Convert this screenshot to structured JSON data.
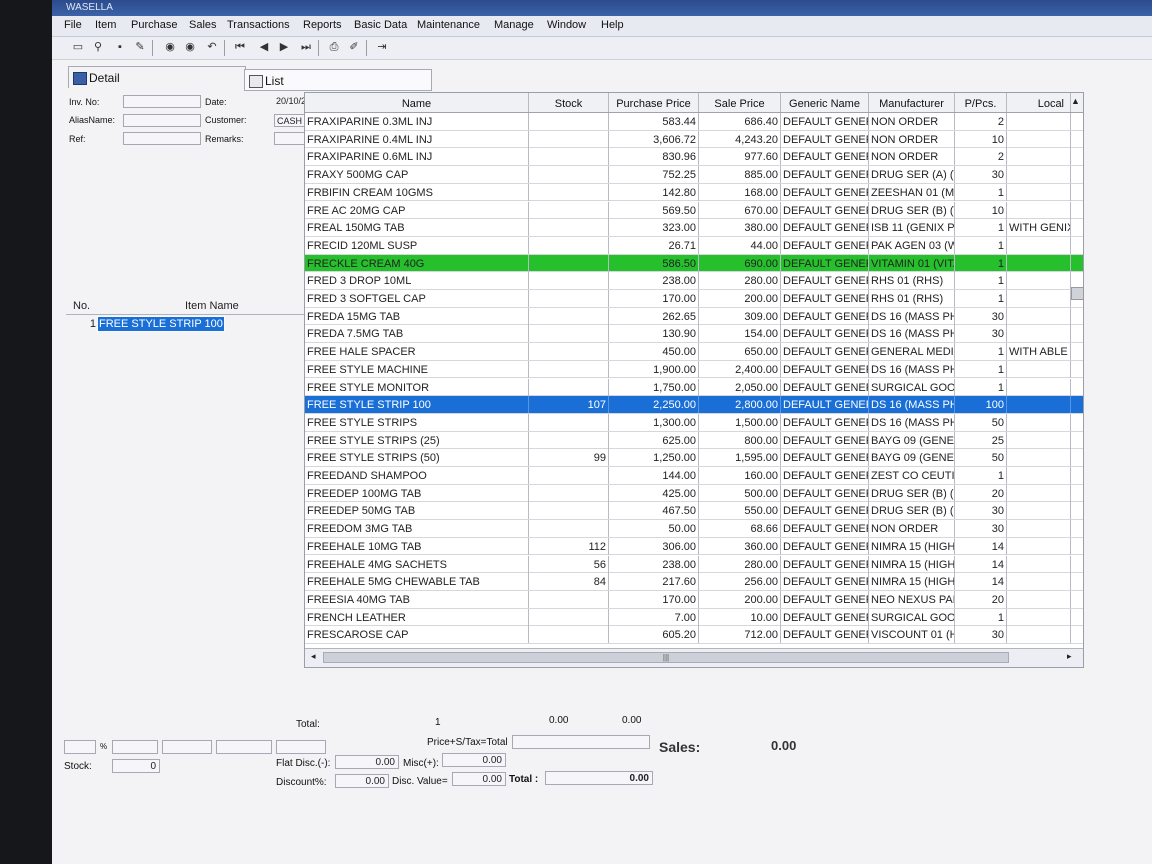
{
  "app": {
    "title": "WASELLA",
    "menu": [
      "File",
      "Item",
      "Purchase",
      "Sales",
      "Transactions",
      "Reports",
      "Basic Data",
      "Maintenance",
      "Manage",
      "Window",
      "Help"
    ]
  },
  "toolbar": {
    "icons": [
      "new-icon",
      "find-icon",
      "save-icon",
      "edit-icon",
      "first-record-icon",
      "last-record-icon",
      "undo-icon",
      "first-page-icon",
      "prev-icon",
      "next-icon",
      "last-page-icon",
      "print-icon",
      "pay-icon",
      "export-icon"
    ]
  },
  "tabs": {
    "detail": "Detail",
    "list": "List"
  },
  "form": {
    "inv_no_label": "Inv. No:",
    "alias_label": "AliasName:",
    "ref_label": "Ref:",
    "date_label": "Date:",
    "date_value": "20/10/2",
    "customer_label": "Customer:",
    "customer_value": "CASH",
    "remarks_label": "Remarks:"
  },
  "items_list": {
    "no_header": "No.",
    "name_header": "Item Name",
    "rows": [
      {
        "no": "1",
        "name": "FREE STYLE STRIP 100"
      }
    ]
  },
  "grid": {
    "headers": [
      "Name",
      "Stock",
      "Purchase Price",
      "Sale Price",
      "Generic Name",
      "Manufacturer",
      "P/Pcs.",
      "Local"
    ],
    "rows": [
      {
        "name": "FRAXIPARINE 0.3ML INJ",
        "stock": "",
        "pp": "583.44",
        "sp": "686.40",
        "gen": "DEFAULT GENER",
        "mfr": "NON ORDER",
        "pcs": "2",
        "local": ""
      },
      {
        "name": "FRAXIPARINE 0.4ML INJ",
        "stock": "",
        "pp": "3,606.72",
        "sp": "4,243.20",
        "gen": "DEFAULT GENER",
        "mfr": "NON ORDER",
        "pcs": "10",
        "local": ""
      },
      {
        "name": "FRAXIPARINE 0.6ML INJ",
        "stock": "",
        "pp": "830.96",
        "sp": "977.60",
        "gen": "DEFAULT GENER",
        "mfr": "NON ORDER",
        "pcs": "2",
        "local": ""
      },
      {
        "name": "FRAXY 500MG CAP",
        "stock": "",
        "pp": "752.25",
        "sp": "885.00",
        "gen": "DEFAULT GENER",
        "mfr": "DRUG SER (A) (T",
        "pcs": "30",
        "local": ""
      },
      {
        "name": "FRBIFIN CREAM 10GMS",
        "stock": "",
        "pp": "142.80",
        "sp": "168.00",
        "gen": "DEFAULT GENER",
        "mfr": "ZEESHAN 01 (MI",
        "pcs": "1",
        "local": ""
      },
      {
        "name": "FRE AC 20MG CAP",
        "stock": "",
        "pp": "569.50",
        "sp": "670.00",
        "gen": "DEFAULT GENER",
        "mfr": "DRUG SER (B) (V",
        "pcs": "10",
        "local": ""
      },
      {
        "name": "FREAL 150MG TAB",
        "stock": "",
        "pp": "323.00",
        "sp": "380.00",
        "gen": "DEFAULT GENER",
        "mfr": "ISB 11 (GENIX PH",
        "pcs": "1",
        "local": "WITH GENIX"
      },
      {
        "name": "FRECID 120ML SUSP",
        "stock": "",
        "pp": "26.71",
        "sp": "44.00",
        "gen": "DEFAULT GENER",
        "mfr": "PAK AGEN 03 (W",
        "pcs": "1",
        "local": ""
      },
      {
        "name": "FRECKLE CREAM 40G",
        "stock": "",
        "pp": "586.50",
        "sp": "690.00",
        "gen": "DEFAULT GENER",
        "mfr": "VITAMIN 01 (VITA",
        "pcs": "1",
        "local": "",
        "hl": "green"
      },
      {
        "name": "FRED 3 DROP 10ML",
        "stock": "",
        "pp": "238.00",
        "sp": "280.00",
        "gen": "DEFAULT GENER",
        "mfr": "RHS 01 (RHS)",
        "pcs": "1",
        "local": ""
      },
      {
        "name": "FRED 3 SOFTGEL CAP",
        "stock": "",
        "pp": "170.00",
        "sp": "200.00",
        "gen": "DEFAULT GENER",
        "mfr": "RHS 01 (RHS)",
        "pcs": "1",
        "local": ""
      },
      {
        "name": "FREDA 15MG TAB",
        "stock": "",
        "pp": "262.65",
        "sp": "309.00",
        "gen": "DEFAULT GENER",
        "mfr": "DS 16 (MASS PH",
        "pcs": "30",
        "local": ""
      },
      {
        "name": "FREDA 7.5MG TAB",
        "stock": "",
        "pp": "130.90",
        "sp": "154.00",
        "gen": "DEFAULT GENER",
        "mfr": "DS 16 (MASS PH",
        "pcs": "30",
        "local": ""
      },
      {
        "name": "FREE HALE SPACER",
        "stock": "",
        "pp": "450.00",
        "sp": "650.00",
        "gen": "DEFAULT GENER",
        "mfr": "GENERAL MEDIC",
        "pcs": "1",
        "local": "WITH ABLE S"
      },
      {
        "name": "FREE STYLE MACHINE",
        "stock": "",
        "pp": "1,900.00",
        "sp": "2,400.00",
        "gen": "DEFAULT GENER",
        "mfr": "DS 16 (MASS PH",
        "pcs": "1",
        "local": ""
      },
      {
        "name": "FREE STYLE MONITOR",
        "stock": "",
        "pp": "1,750.00",
        "sp": "2,050.00",
        "gen": "DEFAULT GENER",
        "mfr": "SURGICAL GOO",
        "pcs": "1",
        "local": ""
      },
      {
        "name": "FREE STYLE STRIP 100",
        "stock": "107",
        "pp": "2,250.00",
        "sp": "2,800.00",
        "gen": "DEFAULT GENER",
        "mfr": "DS 16 (MASS PH",
        "pcs": "100",
        "local": "",
        "hl": "blue"
      },
      {
        "name": "FREE STYLE STRIPS",
        "stock": "",
        "pp": "1,300.00",
        "sp": "1,500.00",
        "gen": "DEFAULT GENER",
        "mfr": "DS 16 (MASS PH",
        "pcs": "50",
        "local": ""
      },
      {
        "name": "FREE STYLE STRIPS (25)",
        "stock": "",
        "pp": "625.00",
        "sp": "800.00",
        "gen": "DEFAULT GENER",
        "mfr": "BAYG 09 (GENER",
        "pcs": "25",
        "local": ""
      },
      {
        "name": "FREE STYLE STRIPS (50)",
        "stock": "99",
        "pp": "1,250.00",
        "sp": "1,595.00",
        "gen": "DEFAULT GENER",
        "mfr": "BAYG 09 (GENER",
        "pcs": "50",
        "local": ""
      },
      {
        "name": "FREEDAND SHAMPOO",
        "stock": "",
        "pp": "144.00",
        "sp": "160.00",
        "gen": "DEFAULT GENER",
        "mfr": "ZEST CO CEUTI",
        "pcs": "1",
        "local": ""
      },
      {
        "name": "FREEDEP 100MG TAB",
        "stock": "",
        "pp": "425.00",
        "sp": "500.00",
        "gen": "DEFAULT GENER",
        "mfr": "DRUG SER (B) (",
        "pcs": "20",
        "local": ""
      },
      {
        "name": "FREEDEP 50MG TAB",
        "stock": "",
        "pp": "467.50",
        "sp": "550.00",
        "gen": "DEFAULT GENER",
        "mfr": "DRUG SER (B) (",
        "pcs": "30",
        "local": ""
      },
      {
        "name": "FREEDOM 3MG TAB",
        "stock": "",
        "pp": "50.00",
        "sp": "68.66",
        "gen": "DEFAULT GENER",
        "mfr": "NON ORDER",
        "pcs": "30",
        "local": ""
      },
      {
        "name": "FREEHALE 10MG TAB",
        "stock": "112",
        "pp": "306.00",
        "sp": "360.00",
        "gen": "DEFAULT GENER",
        "mfr": "NIMRA 15 (HIGH",
        "pcs": "14",
        "local": ""
      },
      {
        "name": "FREEHALE 4MG SACHETS",
        "stock": "56",
        "pp": "238.00",
        "sp": "280.00",
        "gen": "DEFAULT GENER",
        "mfr": "NIMRA 15 (HIGH",
        "pcs": "14",
        "local": ""
      },
      {
        "name": "FREEHALE 5MG CHEWABLE TAB",
        "stock": "84",
        "pp": "217.60",
        "sp": "256.00",
        "gen": "DEFAULT GENER",
        "mfr": "NIMRA 15 (HIGH",
        "pcs": "14",
        "local": ""
      },
      {
        "name": "FREESIA 40MG TAB",
        "stock": "",
        "pp": "170.00",
        "sp": "200.00",
        "gen": "DEFAULT GENER",
        "mfr": "NEO NEXUS PAK",
        "pcs": "20",
        "local": ""
      },
      {
        "name": "FRENCH LEATHER",
        "stock": "",
        "pp": "7.00",
        "sp": "10.00",
        "gen": "DEFAULT GENER",
        "mfr": "SURGICAL GOO",
        "pcs": "1",
        "local": ""
      },
      {
        "name": "FRESCAROSE CAP",
        "stock": "",
        "pp": "605.20",
        "sp": "712.00",
        "gen": "DEFAULT GENER",
        "mfr": "VISCOUNT 01 (H",
        "pcs": "30",
        "local": ""
      }
    ]
  },
  "footer": {
    "total_label": "Total:",
    "total_qty": "1",
    "total_a": "0.00",
    "total_b": "0.00",
    "pst_label": "Price+S/Tax=Total",
    "sales_label": "Sales:",
    "sales_value": "0.00",
    "pct_label": "%",
    "stock_label": "Stock:",
    "stock_value": "0",
    "flat_label": "Flat Disc.(-):",
    "flat_value": "0.00",
    "misc_label": "Misc(+):",
    "misc_value": "0.00",
    "disc_label": "Discount%:",
    "disc_value": "0.00",
    "disc_value_label": "Disc. Value=",
    "disc_value_value": "0.00",
    "grand_label": "Total :",
    "grand_value": "0.00"
  },
  "colors": {
    "green_row": "#26c02c",
    "selected_row": "#1a6fd6"
  }
}
